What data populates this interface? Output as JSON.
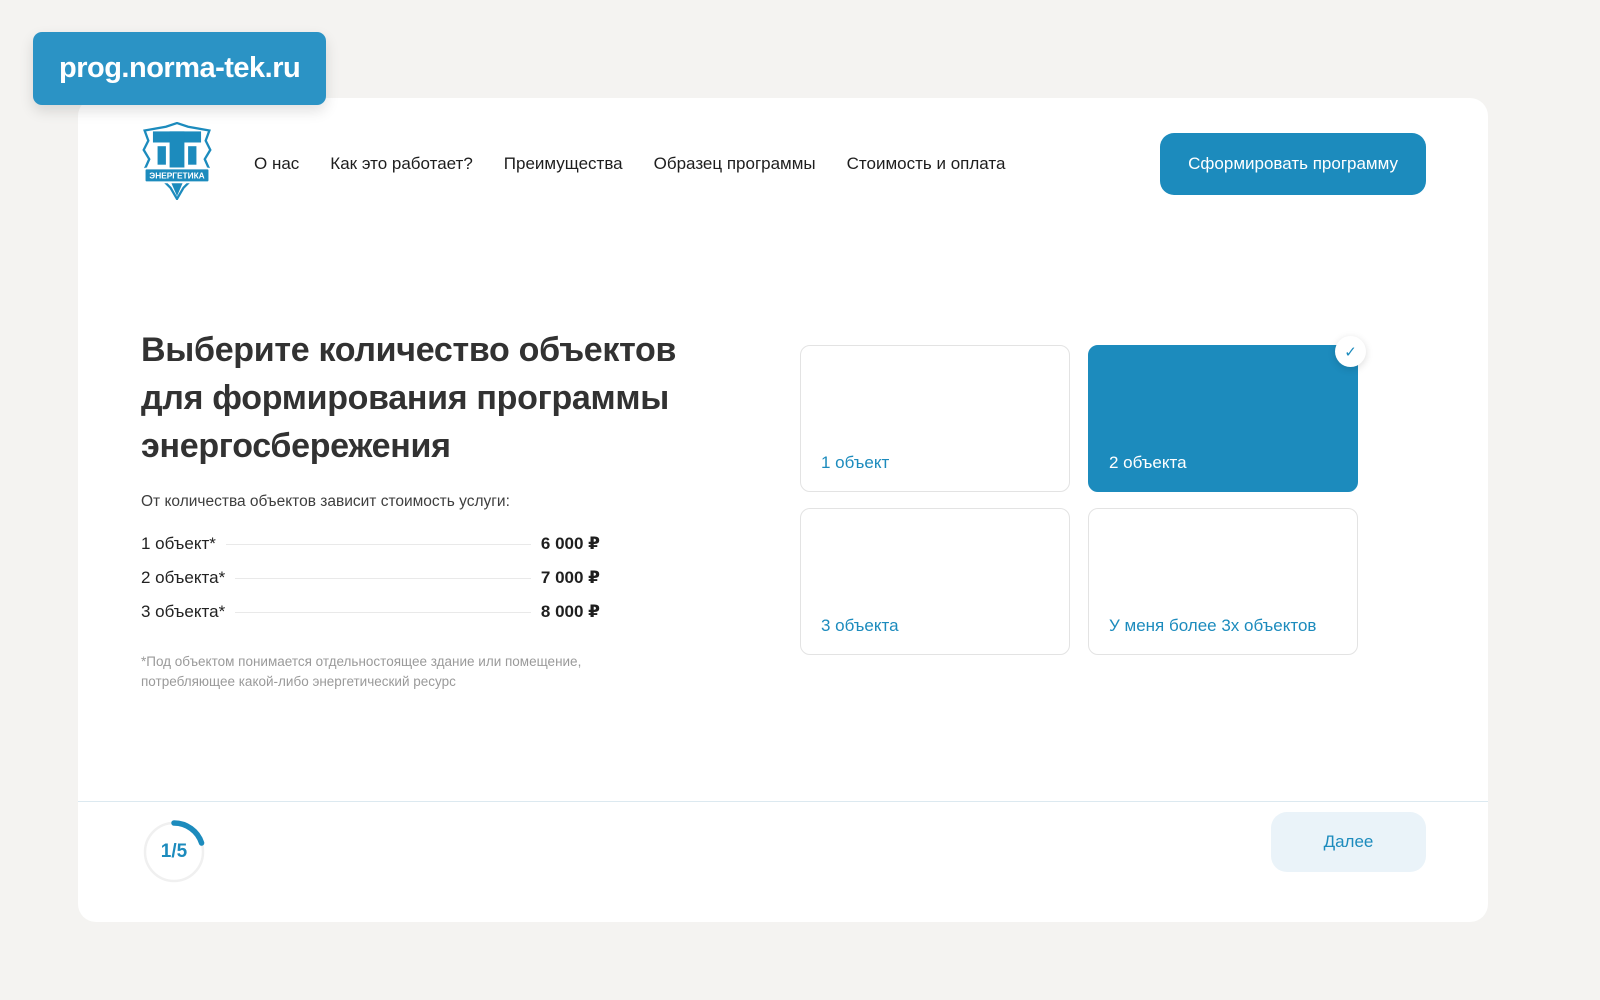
{
  "url_badge": "prog.norma-tek.ru",
  "header": {
    "logo": {
      "banner_text": "ЭНЕРГЕТИКА",
      "monogram": "ПТ"
    },
    "nav": [
      {
        "label": "О нас"
      },
      {
        "label": "Как это работает?"
      },
      {
        "label": "Преимущества"
      },
      {
        "label": "Образец программы"
      },
      {
        "label": "Стоимость и оплата"
      }
    ],
    "cta_label": "Сформировать программу"
  },
  "main": {
    "heading": "Выберите количество объектов для формирования программы энергосбережения",
    "subheading": "От количества объектов зависит стоимость услуги:",
    "price_list": [
      {
        "label": "1 объект*",
        "price": "6 000 ₽"
      },
      {
        "label": "2 объекта*",
        "price": "7 000 ₽"
      },
      {
        "label": "3 объекта*",
        "price": "8 000 ₽"
      }
    ],
    "footnote": "*Под объектом понимается отдельностоящее здание или помещение, потребляющее какой-либо энергетический ресурс",
    "options": [
      {
        "label": "1 объект",
        "selected": false
      },
      {
        "label": "2 объекта",
        "selected": true
      },
      {
        "label": "3 объекта",
        "selected": false
      },
      {
        "label": "У меня более 3х объектов",
        "selected": false
      }
    ],
    "check_icon": "✓"
  },
  "footer": {
    "progress": "1/5",
    "next_label": "Далее"
  },
  "colors": {
    "accent": "#1C8BBD",
    "url_badge_bg": "#2B93C5",
    "page_bg": "#F4F3F1",
    "next_button_bg": "#EAF3F9",
    "selected_card_bg": "#1C8BBD"
  }
}
